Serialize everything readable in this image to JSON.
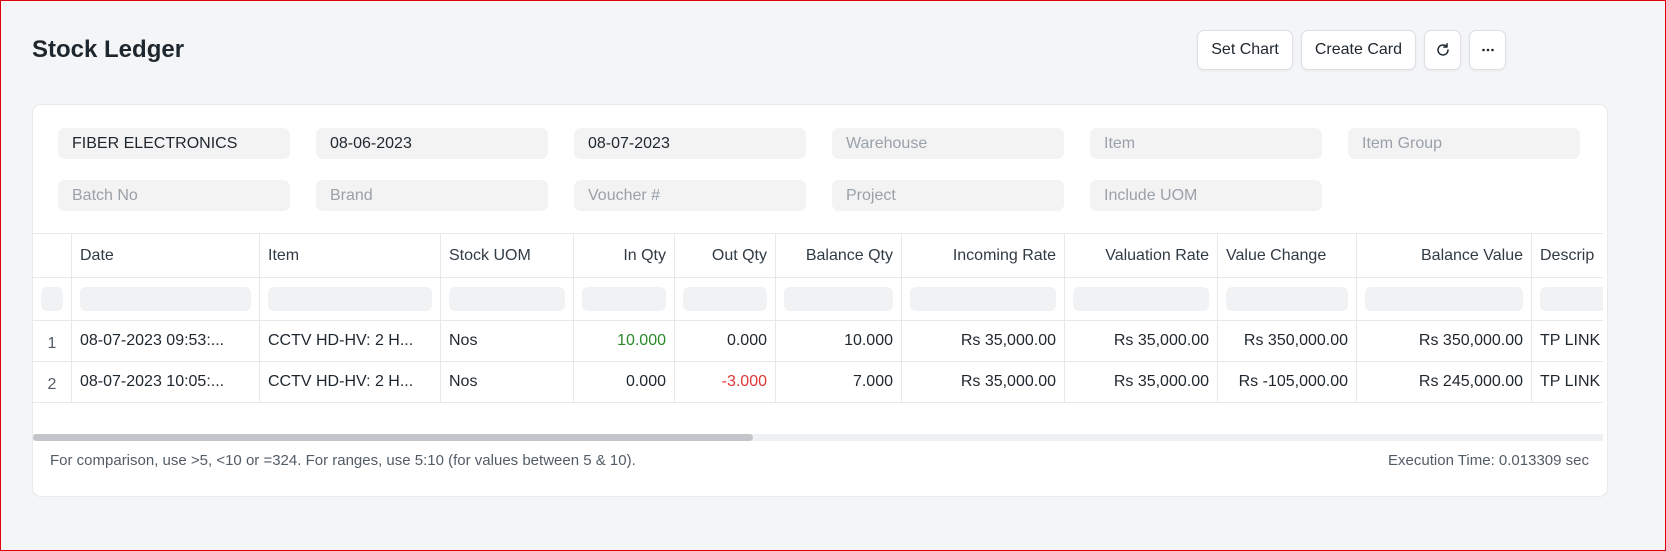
{
  "page": {
    "title": "Stock Ledger"
  },
  "actions": {
    "set_chart": "Set Chart",
    "create_card": "Create Card",
    "refresh_icon": "refresh-icon",
    "more_icon": "ellipsis-icon"
  },
  "filters": {
    "company": "FIBER ELECTRONICS",
    "from_date": "08-06-2023",
    "to_date": "08-07-2023",
    "warehouse": "Warehouse",
    "item": "Item",
    "item_group": "Item Group",
    "batch_no": "Batch No",
    "brand": "Brand",
    "voucher": "Voucher #",
    "project": "Project",
    "include_uom": "Include UOM"
  },
  "table": {
    "columns": [
      "Date",
      "Item",
      "Stock UOM",
      "In Qty",
      "Out Qty",
      "Balance Qty",
      "Incoming Rate",
      "Valuation Rate",
      "Value Change",
      "Balance Value",
      "Descrip"
    ],
    "rows": [
      {
        "num": "1",
        "date": "08-07-2023 09:53:...",
        "item": "CCTV HD-HV: 2 H...",
        "uom": "Nos",
        "in_qty": "10.000",
        "out_qty": "0.000",
        "balance_qty": "10.000",
        "incoming_rate": "Rs 35,000.00",
        "valuation_rate": "Rs 35,000.00",
        "value_change": "Rs 350,000.00",
        "balance_value": "Rs 350,000.00",
        "description": "TP LINK"
      },
      {
        "num": "2",
        "date": "08-07-2023 10:05:...",
        "item": "CCTV HD-HV: 2 H...",
        "uom": "Nos",
        "in_qty": "0.000",
        "out_qty": "-3.000",
        "balance_qty": "7.000",
        "incoming_rate": "Rs 35,000.00",
        "valuation_rate": "Rs 35,000.00",
        "value_change": "Rs -105,000.00",
        "balance_value": "Rs 245,000.00",
        "description": "TP LINK"
      }
    ]
  },
  "footer": {
    "hint": "For comparison, use >5, <10 or =324. For ranges, use 5:10 (for values between 5 & 10).",
    "execution_time": "Execution Time: 0.013309 sec"
  },
  "colors": {
    "positive": "#2a8a2a",
    "negative": "#e03636"
  }
}
